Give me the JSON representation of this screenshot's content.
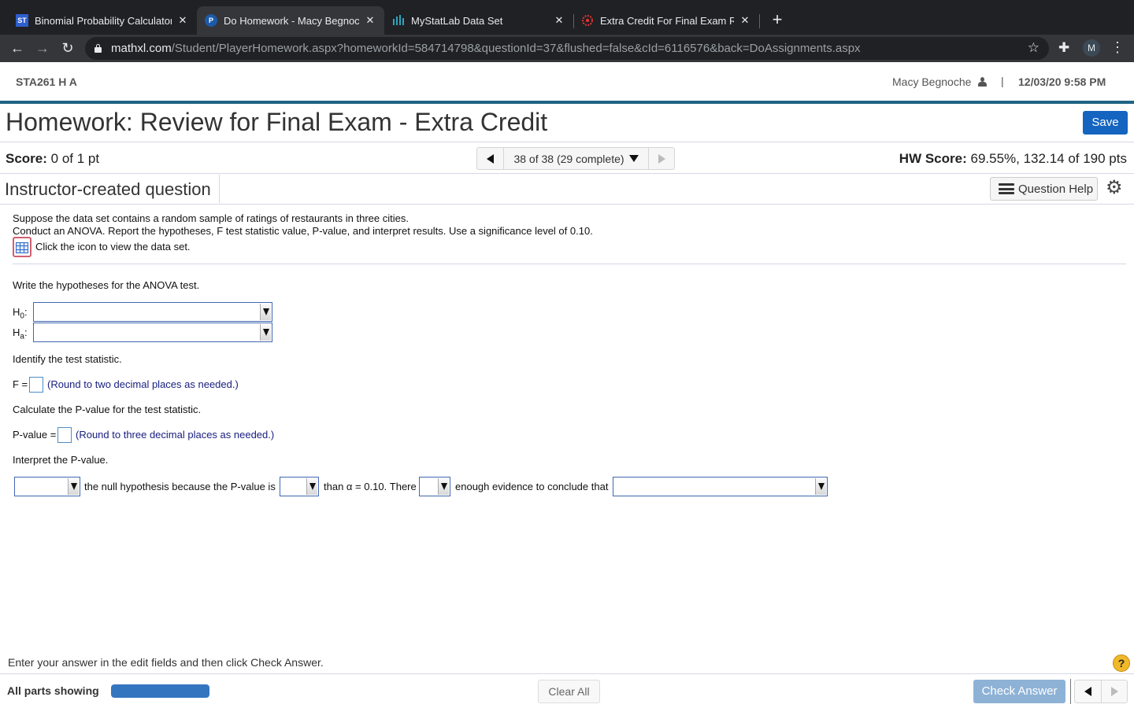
{
  "browser": {
    "tabs": [
      {
        "title": "Binomial Probability Calculator",
        "favicon": "statistics-icon",
        "active": false
      },
      {
        "title": "Do Homework - Macy Begnoche",
        "favicon": "pearson-icon",
        "active": true
      },
      {
        "title": "MyStatLab Data Set",
        "favicon": "bar-chart-icon",
        "active": false
      },
      {
        "title": "Extra Credit For Final Exam Review",
        "favicon": "canvas-icon",
        "active": false
      }
    ],
    "url_host": "mathxl.com",
    "url_path": "/Student/PlayerHomework.aspx?homeworkId=584714798&questionId=37&flushed=false&cId=6116576&back=DoAssignments.aspx",
    "profile_initial": "M"
  },
  "header": {
    "course": "STA261 H A",
    "user_name": "Macy Begnoche",
    "separator": "|",
    "datetime": "12/03/20 9:58 PM"
  },
  "homework": {
    "title": "Homework: Review for Final Exam - Extra Credit",
    "save_label": "Save",
    "score_label": "Score:",
    "score_value": "0 of 1 pt",
    "question_nav": "38 of 38 (29 complete)",
    "hw_score_label": "HW Score:",
    "hw_score_value": "69.55%, 132.14 of 190 pts",
    "question_type": "Instructor-created question",
    "question_help_label": "Question Help"
  },
  "question": {
    "line1": "Suppose the data set contains a random sample of ratings of restaurants in three cities.",
    "line2": "Conduct an ANOVA. Report the hypotheses, F test statistic value, P-value, and interpret results. Use a significance level of 0.10.",
    "data_icon_text": "Click the icon to view the data set.",
    "hypotheses_prompt": "Write the hypotheses for the ANOVA test.",
    "h0_label": "H",
    "h0_sub": "0",
    "ha_label": "H",
    "ha_sub": "a",
    "h0_value": "",
    "ha_value": "",
    "stat_prompt": "Identify the test statistic.",
    "f_label": "F =",
    "f_value": "",
    "f_hint": "(Round to two decimal places as needed.)",
    "p_prompt": "Calculate the P-value for the test statistic.",
    "p_label": "P-value =",
    "p_value": "",
    "p_hint": "(Round to three decimal places as needed.)",
    "interpret_prompt": "Interpret the P-value.",
    "interp_text1": "the null hypothesis because the P-value is",
    "interp_text2": "than α = 0.10. There",
    "interp_text3": "enough evidence to conclude that",
    "decision_value": "",
    "comparison_value": "",
    "evidence_value": "",
    "conclusion_value": ""
  },
  "footer": {
    "instruction": "Enter your answer in the edit fields and then click Check Answer.",
    "all_parts": "All parts showing",
    "progress_percent": 100,
    "clear_all": "Clear All",
    "check_answer": "Check Answer",
    "help_symbol": "?"
  }
}
